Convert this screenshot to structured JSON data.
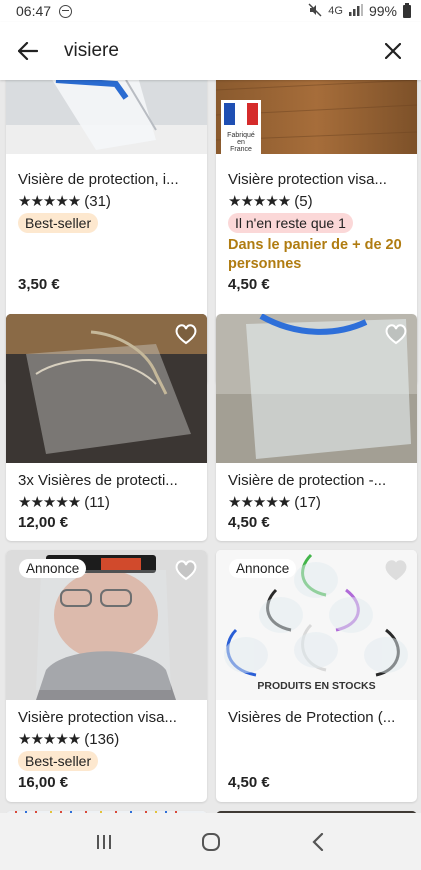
{
  "status": {
    "time": "06:47",
    "network": "4G",
    "battery": "99%"
  },
  "search": {
    "query": "visiere"
  },
  "products": [
    {
      "title": "Visière de protection, i...",
      "stars": "★★★★★",
      "reviews": "(31)",
      "badge": "Best-seller",
      "price": "3,50 €"
    },
    {
      "title": "Visière protection visa...",
      "stars": "★★★★★",
      "reviews": "(5)",
      "badge": "Il n'en reste que 1",
      "promo": "Dans le panier de + de 20 personnes",
      "price": "4,50 €",
      "flag_text": "Fabriqué en France"
    },
    {
      "title": "3x Visières de protecti...",
      "stars": "★★★★★",
      "reviews": "(11)",
      "price": "12,00 €"
    },
    {
      "title": "Visière de protection -...",
      "stars": "★★★★★",
      "reviews": "(17)",
      "price": "4,50 €"
    },
    {
      "title": "Visière protection visa...",
      "stars": "★★★★★",
      "reviews": "(136)",
      "badge": "Best-seller",
      "price": "16,00 €",
      "ad_label": "Annonce"
    },
    {
      "title": "Visières de Protection (...",
      "price": "4,50 €",
      "ad_label": "Annonce",
      "image_text": "PRODUITS EN STOCKS"
    }
  ],
  "colors": {
    "bestseller_bg": "#fde8cf",
    "stock_bg": "#fbd8d8",
    "promo_text": "#b07c11"
  },
  "icons": {
    "back": "arrow-left-icon",
    "close": "close-icon",
    "favorite": "heart-outline-icon",
    "recents": "recents-icon",
    "home": "home-icon",
    "back_nav": "chevron-left-icon"
  }
}
